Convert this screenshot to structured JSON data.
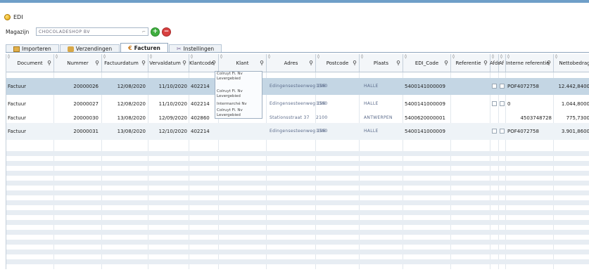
{
  "app": {
    "title": "EDI",
    "icon": "app-logo-icon"
  },
  "magazijn": {
    "label": "Magazijn",
    "value": "CHOCOLADESHOP BV"
  },
  "tabs": [
    {
      "label": "Importeren",
      "icon": "import-icon"
    },
    {
      "label": "Verzendingen",
      "icon": "truck-icon"
    },
    {
      "label": "Facturen",
      "icon": "euro-icon"
    },
    {
      "label": "Instellingen",
      "icon": "tools-icon"
    }
  ],
  "active_tab": "Facturen",
  "columns": [
    "Document",
    "Nummer",
    "Factuurdatum",
    "Vervaldatum",
    "Klantcode",
    "Klant",
    "Adres",
    "Postcode",
    "Plaats",
    "EDI_Code",
    "Referentie",
    "Afdr",
    "Af",
    "Interne referentie",
    "Nettobedrag"
  ],
  "rows": [
    {
      "document": "Factuur",
      "nummer": "20000026",
      "factuurdatum": "12/08/2020",
      "vervaldatum": "11/10/2020",
      "klantcode": "402214",
      "klant": "Colruyt Fi. Nv Levergebied",
      "adres": "Edingensesteenweg 196",
      "postcode": "1500",
      "plaats": "HALLE",
      "edi_code": "5400141000009",
      "referentie": "",
      "interne_referentie": "POF4072758",
      "nettobedrag": "12.442,8400"
    },
    {
      "document": "Factuur",
      "nummer": "20000027",
      "factuurdatum": "12/08/2020",
      "vervaldatum": "11/10/2020",
      "klantcode": "402214",
      "klant": "Colruyt Fi. Nv Levergebied",
      "adres": "Edingensesteenweg 196",
      "postcode": "1500",
      "plaats": "HALLE",
      "edi_code": "5400141000009",
      "referentie": "",
      "interne_referentie": "0",
      "nettobedrag": "1.044,8000"
    },
    {
      "document": "Factuur",
      "nummer": "20000030",
      "factuurdatum": "13/08/2020",
      "vervaldatum": "12/09/2020",
      "klantcode": "402860",
      "klant": "Intermarché Nv",
      "adres": "Stationsstraat 37",
      "postcode": "2100",
      "plaats": "ANTWERPEN",
      "edi_code": "5400620000001",
      "referentie": "",
      "interne_referentie": "4503748728",
      "nettobedrag": "775,7300"
    },
    {
      "document": "Factuur",
      "nummer": "20000031",
      "factuurdatum": "13/08/2020",
      "vervaldatum": "12/10/2020",
      "klantcode": "402214",
      "klant": "Colruyt Fi. Nv Levergebied",
      "adres": "Edingensesteenweg 196",
      "postcode": "1500",
      "plaats": "HALLE",
      "edi_code": "5400141000009",
      "referentie": "",
      "interne_referentie": "POF4072758",
      "nettobedrag": "3.901,8600"
    }
  ],
  "colors": {
    "selection": "#c4d6e4",
    "stripe": "#e7edf3",
    "header": "#f3f6f9",
    "accent": "#6f9fc8"
  }
}
